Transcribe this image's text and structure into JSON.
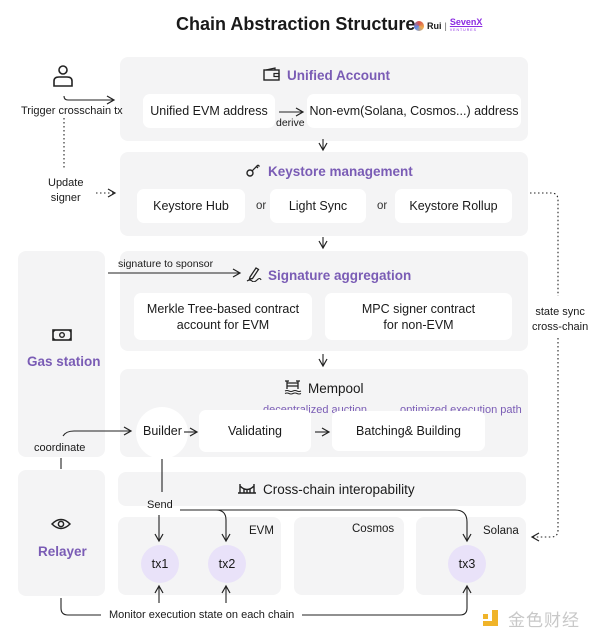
{
  "title": "Chain Abstraction Structure",
  "brand": {
    "author": "Rui",
    "separator": "|",
    "org": "SevenX",
    "org_sub": "VENTURES",
    "org_color": "#8b2be2"
  },
  "colors": {
    "accent_purple": "#7a5cb5",
    "panel_bg": "#f4f4f5",
    "tx_bubble": "#e9e2f9",
    "watermark_yellow": "#f0b429"
  },
  "user": {
    "icon": "user-icon",
    "trigger_label": "Trigger crosschain tx",
    "update_signer_label": "Update\nsigner"
  },
  "unified_account": {
    "icon": "wallet-icon",
    "title": "Unified Account",
    "evm_card": "Unified EVM address",
    "derive_label": "derive",
    "non_evm_card": "Non-evm(Solana, Cosmos...) address"
  },
  "keystore": {
    "icon": "key-icon",
    "title": "Keystore management",
    "options": [
      "Keystore Hub",
      "Light Sync",
      "Keystore Rollup"
    ],
    "or_label": "or"
  },
  "signature": {
    "icon": "signature-pen-icon",
    "title": "Signature aggregation",
    "sponsor_label": "signature to sponsor",
    "cards": [
      "Merkle Tree-based contract\naccount for EVM",
      "MPC signer contract\nfor non-EVM"
    ]
  },
  "gas_station": {
    "icon": "money-icon",
    "title": "Gas station",
    "coordinate_label": "coordinate"
  },
  "mempool": {
    "icon": "pool-icon",
    "title": "Mempool",
    "builder": "Builder",
    "validating": "Validating",
    "batching": "Batching& Building",
    "note_auction": "decentralized auction",
    "note_path": "optimized execution path"
  },
  "state_sync": {
    "label": "state sync\ncross-chain"
  },
  "relayer": {
    "icon": "eye-icon",
    "title": "Relayer"
  },
  "interop": {
    "icon": "bridge-icon",
    "title": "Cross-chain interopability",
    "send_label": "Send",
    "chains": [
      {
        "name": "EVM",
        "txs": [
          "tx1",
          "tx2"
        ]
      },
      {
        "name": "Cosmos",
        "txs": []
      },
      {
        "name": "Solana",
        "txs": [
          "tx3"
        ]
      }
    ],
    "monitor_label": "Monitor execution state on each chain"
  },
  "watermark": {
    "text": "金色财经"
  }
}
